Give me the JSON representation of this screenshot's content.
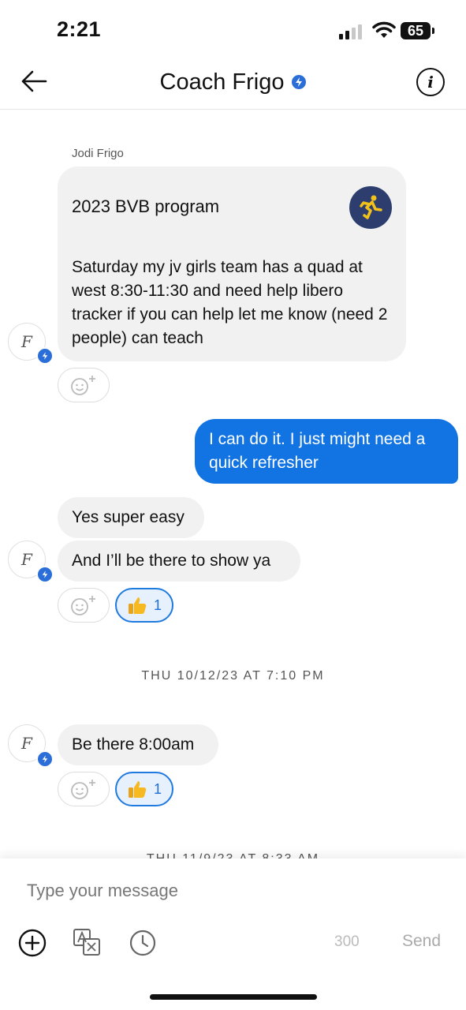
{
  "status_bar": {
    "time": "2:21",
    "battery": "65"
  },
  "header": {
    "title": "Coach Frigo"
  },
  "messages": {
    "sender_name": "Jodi Frigo",
    "avatar_initial": "F",
    "program_title": "2023 BVB program",
    "program_body": "Saturday my jv girls team has a quad at west 8:30-11:30 and need help libero tracker if you can help let me know (need 2 people) can teach",
    "outgoing_1": "I can do it. I just might need a quick refresher",
    "incoming_2": "Yes super easy",
    "incoming_3": "And I’ll be there to show ya",
    "reaction_count_1": "1",
    "date_separator_1": "THU 10/12/23 AT 7:10 PM",
    "incoming_4": "Be there 8:00am",
    "reaction_count_2": "1",
    "date_separator_2": "THU 11/9/23 AT 8:33 AM"
  },
  "composer": {
    "placeholder": "Type your message",
    "char_count": "300",
    "send_label": "Send"
  },
  "colors": {
    "accent": "#1274e3",
    "bubble_in": "#f1f1f1",
    "badge": "#2b6ed8"
  }
}
